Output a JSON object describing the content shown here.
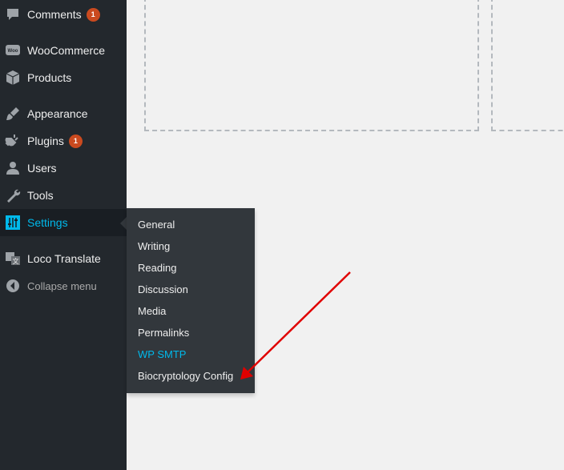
{
  "sidebar": {
    "items": [
      {
        "key": "comments",
        "label": "Comments",
        "badge": "1",
        "icon": "comments-icon"
      },
      {
        "key": "woocommerce",
        "label": "WooCommerce",
        "icon": "woocommerce-icon"
      },
      {
        "key": "products",
        "label": "Products",
        "icon": "products-box-icon"
      },
      {
        "key": "appearance",
        "label": "Appearance",
        "icon": "brush-icon"
      },
      {
        "key": "plugins",
        "label": "Plugins",
        "badge": "1",
        "icon": "plug-icon"
      },
      {
        "key": "users",
        "label": "Users",
        "icon": "user-icon"
      },
      {
        "key": "tools",
        "label": "Tools",
        "icon": "wrench-icon"
      },
      {
        "key": "settings",
        "label": "Settings",
        "icon": "settings-sliders-icon",
        "current": true
      },
      {
        "key": "loco-translate",
        "label": "Loco Translate",
        "icon": "translate-icon"
      },
      {
        "key": "collapse",
        "label": "Collapse menu",
        "icon": "collapse-arrow-icon"
      }
    ]
  },
  "settings_submenu": {
    "items": [
      {
        "label": "General"
      },
      {
        "label": "Writing"
      },
      {
        "label": "Reading"
      },
      {
        "label": "Discussion"
      },
      {
        "label": "Media"
      },
      {
        "label": "Permalinks"
      },
      {
        "label": "WP SMTP",
        "active": true
      },
      {
        "label": "Biocryptology Config"
      }
    ]
  },
  "colors": {
    "sidebar_bg": "#23282d",
    "submenu_bg": "#32373c",
    "accent": "#00b9eb",
    "badge": "#ca4a1f",
    "annotation_arrow": "#e00000",
    "content_bg": "#f1f1f1"
  }
}
